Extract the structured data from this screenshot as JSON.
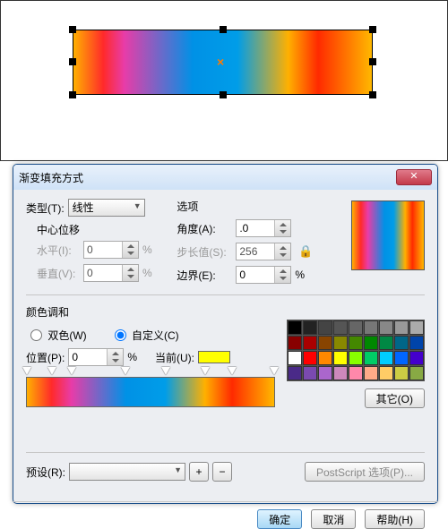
{
  "dialog": {
    "title": "渐变填充方式",
    "close_glyph": "✕",
    "type_label": "类型(T):",
    "type_value": "线性",
    "center_offset": "中心位移",
    "horiz_label": "水平(I):",
    "vert_label": "垂直(V):",
    "horiz_value": "0",
    "vert_value": "0",
    "pct": "%",
    "options_title": "选项",
    "angle_label": "角度(A):",
    "angle_value": ".0",
    "step_label": "步长值(S):",
    "step_value": "256",
    "edge_label": "边界(E):",
    "edge_value": "0",
    "lock_glyph": "🔒",
    "blend_title": "颜色调和",
    "two_color_label": "双色(W)",
    "custom_label": "自定义(C)",
    "position_label": "位置(P):",
    "position_value": "0",
    "current_label": "当前(U):",
    "other_btn": "其它(O)",
    "preset_label": "预设(R):",
    "plus": "+",
    "minus": "−",
    "ps_btn": "PostScript 选项(P)...",
    "ok": "确定",
    "cancel": "取消",
    "help": "帮助(H)"
  },
  "gradient_stops": [
    0,
    10,
    18,
    40,
    56,
    72,
    83,
    100
  ],
  "palette_colors": [
    "#000",
    "#222",
    "#444",
    "#555",
    "#666",
    "#777",
    "#888",
    "#999",
    "#aaa",
    "#880000",
    "#aa0000",
    "#884400",
    "#888800",
    "#448800",
    "#008800",
    "#008844",
    "#006688",
    "#0044aa",
    "#ffffff",
    "#ff0000",
    "#ff8800",
    "#ffff00",
    "#88ff00",
    "#00cc66",
    "#00ccff",
    "#0066ff",
    "#4400cc",
    "#4a2a88",
    "#7a4ab0",
    "#aa66cc",
    "#cc88bb",
    "#ff88aa",
    "#ffaa88",
    "#ffcc66",
    "#cccc44",
    "#88aa44"
  ]
}
